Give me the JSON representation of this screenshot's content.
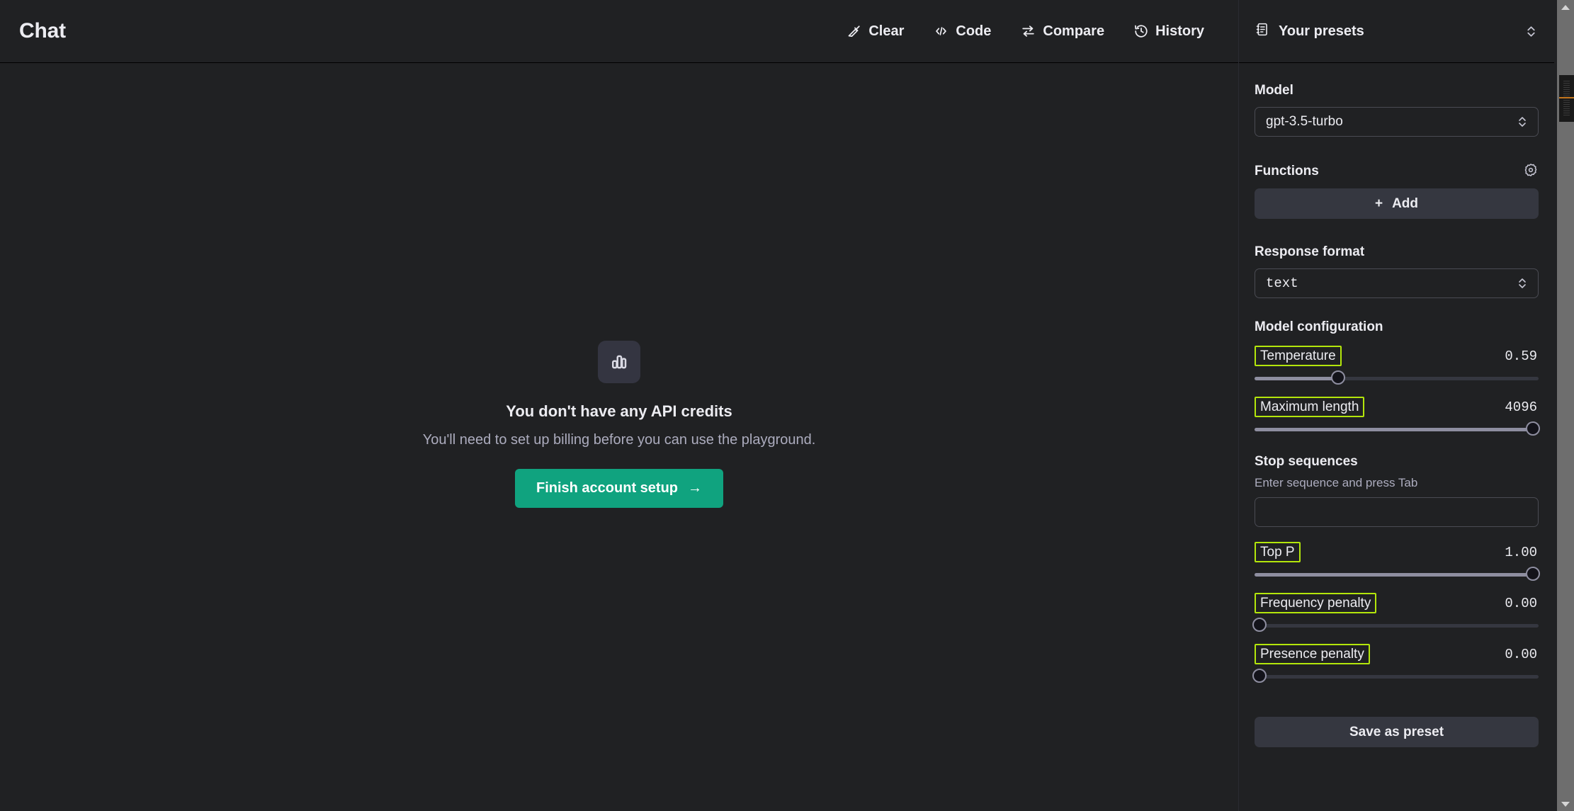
{
  "header": {
    "title": "Chat",
    "actions": [
      {
        "label": "Clear",
        "icon": "broom-icon"
      },
      {
        "label": "Code",
        "icon": "code-brackets-icon"
      },
      {
        "label": "Compare",
        "icon": "compare-arrows-icon"
      },
      {
        "label": "History",
        "icon": "clock-history-icon"
      }
    ]
  },
  "empty_state": {
    "icon": "bar-chart-icon",
    "title": "You don't have any API credits",
    "subtitle": "You'll need to set up billing before you can use the playground.",
    "cta_label": "Finish account setup",
    "cta_arrow": "→",
    "cta_color": "#10a37f"
  },
  "sidebar": {
    "header": {
      "title": "Your presets",
      "icon": "notebook-presets-icon",
      "toggle_icon": "chevron-updown-icon"
    },
    "model": {
      "label": "Model",
      "value": "gpt-3.5-turbo",
      "chevron_icon": "chevron-updown-icon"
    },
    "functions": {
      "label": "Functions",
      "settings_icon": "gear-icon",
      "add_label": "Add",
      "add_plus": "+"
    },
    "response_format": {
      "label": "Response format",
      "value": "text",
      "chevron_icon": "chevron-updown-icon"
    },
    "model_configuration": {
      "label": "Model configuration",
      "highlight_color": "#b3e60b",
      "sliders": [
        {
          "name": "Temperature",
          "value": "0.59",
          "percent": 29.5,
          "highlighted": true
        },
        {
          "name": "Maximum length",
          "value": "4096",
          "percent": 98.0,
          "highlighted": true
        },
        {
          "name": "Top P",
          "value": "1.00",
          "percent": 98.0,
          "highlighted": true
        },
        {
          "name": "Frequency penalty",
          "value": "0.00",
          "percent": 1.8,
          "highlighted": true
        },
        {
          "name": "Presence penalty",
          "value": "0.00",
          "percent": 1.8,
          "highlighted": true
        }
      ]
    },
    "stop_sequences": {
      "label": "Stop sequences",
      "hint": "Enter sequence and press Tab",
      "value": "",
      "placeholder": ""
    },
    "save_preset_label": "Save as preset"
  },
  "scrollbar": {
    "up_icon": "scroll-up-arrow-icon",
    "down_icon": "scroll-down-arrow-icon"
  }
}
